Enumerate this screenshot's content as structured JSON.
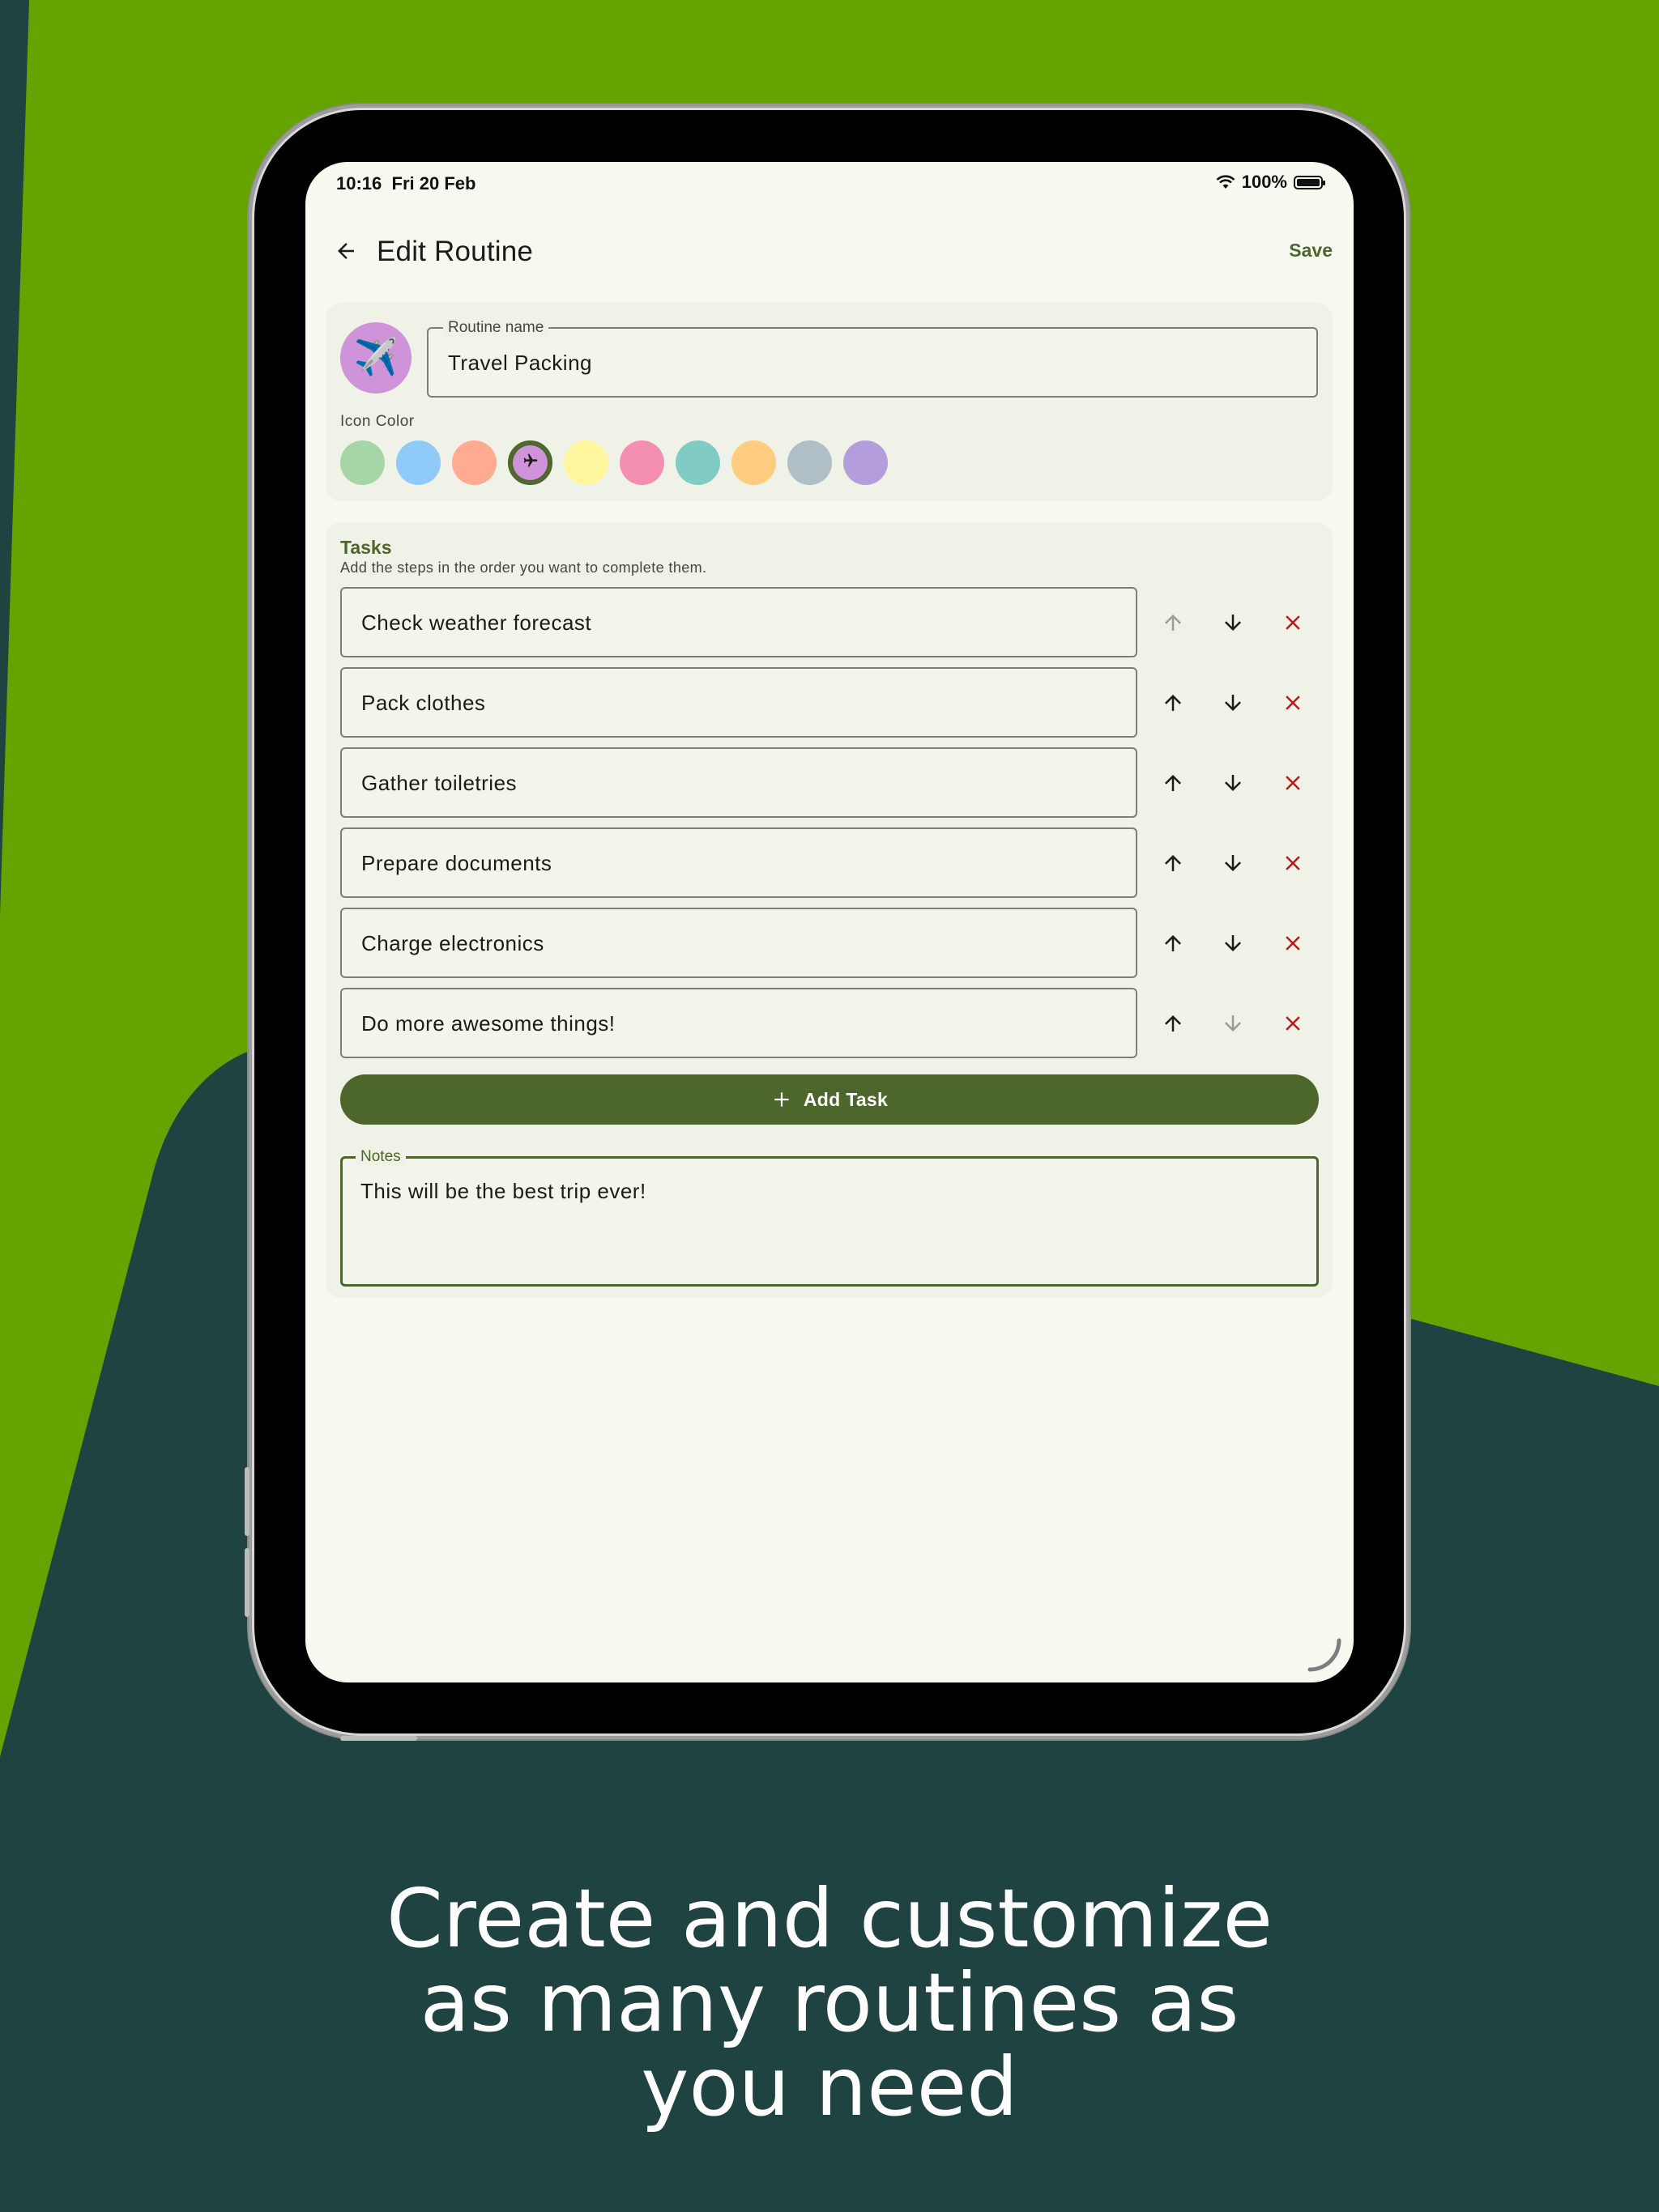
{
  "status_bar": {
    "time": "10:16",
    "date": "Fri 20 Feb",
    "battery": "100%"
  },
  "app_bar": {
    "title": "Edit Routine",
    "save_label": "Save"
  },
  "routine": {
    "name_label": "Routine name",
    "name_value": "Travel Packing",
    "icon": "airplane-icon",
    "icon_glyph": "✈️",
    "icon_color_label": "Icon Color",
    "colors": [
      "#a5d6a7",
      "#90caf9",
      "#ffab91",
      "#ce93d8",
      "#fff59d",
      "#f48fb1",
      "#80cbc4",
      "#ffcc80",
      "#b0bec5",
      "#b39ddb"
    ],
    "selected_color_index": 3
  },
  "tasks": {
    "title": "Tasks",
    "subtitle": "Add the steps in the order you want to complete them.",
    "items": [
      {
        "label": "Check weather forecast",
        "up_enabled": false,
        "down_enabled": true
      },
      {
        "label": "Pack clothes",
        "up_enabled": true,
        "down_enabled": true
      },
      {
        "label": "Gather toiletries",
        "up_enabled": true,
        "down_enabled": true
      },
      {
        "label": "Prepare documents",
        "up_enabled": true,
        "down_enabled": true
      },
      {
        "label": "Charge electronics",
        "up_enabled": true,
        "down_enabled": true
      },
      {
        "label": "Do more awesome things!",
        "up_enabled": true,
        "down_enabled": false
      }
    ],
    "add_label": "Add Task"
  },
  "notes": {
    "label": "Notes",
    "value": "This will be the best trip ever!"
  },
  "tagline": {
    "line1": "Create and customize",
    "line2": "as many routines as",
    "line3": "you need"
  },
  "colors": {
    "background_dark": "#1f4341",
    "background_green": "#64a300",
    "accent": "#4c662b",
    "delete": "#ba1a1a",
    "screen": "#f7f8f0"
  }
}
